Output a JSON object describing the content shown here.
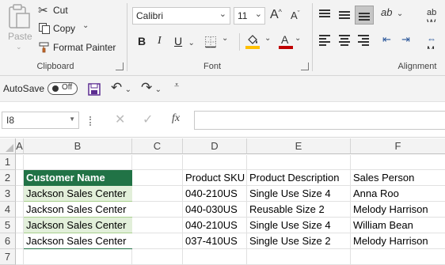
{
  "ribbon": {
    "clipboard": {
      "paste_label": "Paste",
      "cut_label": "Cut",
      "copy_label": "Copy",
      "format_painter_label": "Format Painter",
      "group_label": "Clipboard"
    },
    "font": {
      "font_name": "Calibri",
      "font_size": "11",
      "bold": "B",
      "italic": "I",
      "underline": "U",
      "font_color_letter": "A",
      "group_label": "Font"
    },
    "alignment": {
      "group_label": "Alignment",
      "wrap_label": "W",
      "merge_label": "M"
    }
  },
  "qat": {
    "autosave_label": "AutoSave",
    "autosave_state": "Off"
  },
  "formula_bar": {
    "name_box": "I8",
    "fx": "fx",
    "content": ""
  },
  "sheet": {
    "columns": [
      "A",
      "B",
      "C",
      "D",
      "E",
      "F"
    ],
    "rows": [
      "1",
      "2",
      "3",
      "4",
      "5",
      "6",
      "7"
    ],
    "headers": {
      "customer_name": "Customer Name",
      "product_sku": "Product SKU",
      "product_description": "Product Description",
      "sales_person": "Sales Person"
    },
    "data": [
      {
        "customer": "Jackson Sales Center",
        "sku": "040-210US",
        "description": "Single Use Size 4",
        "person": "Anna Roo"
      },
      {
        "customer": "Jackson Sales Center",
        "sku": "040-030US",
        "description": "Reusable Size 2",
        "person": "Melody Harrison"
      },
      {
        "customer": "Jackson Sales Center",
        "sku": "040-210US",
        "description": "Single Use Size 4",
        "person": "William Bean"
      },
      {
        "customer": "Jackson Sales Center",
        "sku": "037-410US",
        "description": "Single Use Size 2",
        "person": "Melody Harrison"
      }
    ]
  },
  "colors": {
    "header_fill": "#217346",
    "band_fill": "#e2efda",
    "accent": "#217346"
  }
}
